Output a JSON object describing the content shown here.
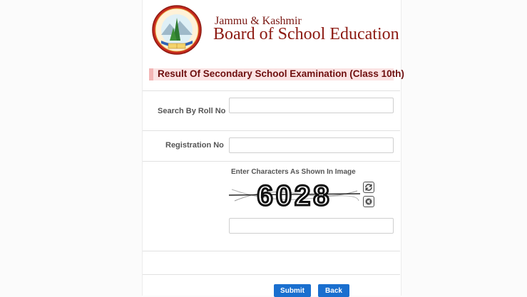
{
  "header": {
    "org_line1": "Jammu & Kashmir",
    "org_line2": "Board of School Education",
    "logo_icon": "jkbose-seal-logo"
  },
  "form": {
    "title": "Result Of Secondary School Examination (Class 10th)",
    "roll_label": "Search By Roll No",
    "roll_value": "",
    "registration_label": "Registration No",
    "registration_value": "",
    "captcha_instruction": "Enter Characters As Shown In Image",
    "captcha_text": "6028",
    "captcha_value": "",
    "refresh_icon": "refresh-icon",
    "audio_icon": "audio-icon"
  },
  "buttons": {
    "submit": "Submit",
    "back": "Back"
  },
  "colors": {
    "brand": "#8c1a12",
    "title_bg": "#fbe3e3",
    "button": "#1a6fcf"
  }
}
